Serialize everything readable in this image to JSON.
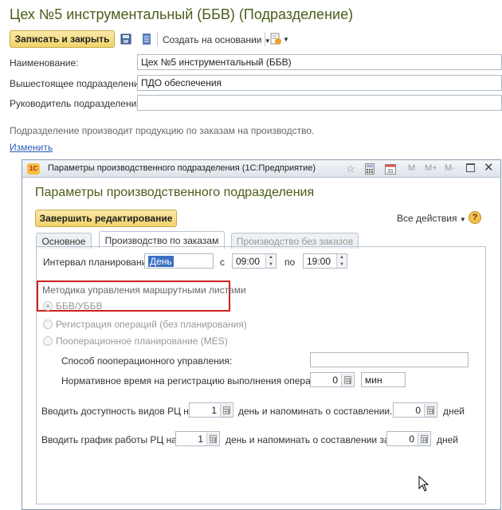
{
  "window": {
    "title": "Цех №5 инструментальный (ББВ) (Подразделение)"
  },
  "toolbar": {
    "save_close_label": "Записать и закрыть",
    "create_based_label": "Создать на основании"
  },
  "form": {
    "name_label": "Наименование:",
    "name_value": "Цех №5 инструментальный (ББВ)",
    "parent_label": "Вышестоящее подразделение:",
    "parent_value": "ПДО обеспечения",
    "head_label": "Руководитель подразделения:",
    "head_value": "",
    "info_text": "Подразделение производит продукцию по заказам на производство.",
    "change_link": "Изменить"
  },
  "dialog": {
    "window_title": "Параметры производственного подразделения  (1С:Предприятие)",
    "header": "Параметры производственного подразделения",
    "finish_button": "Завершить редактирование",
    "all_actions": "Все действия",
    "help": "?",
    "tabs": [
      {
        "label": "Основное"
      },
      {
        "label": "Производство по заказам"
      },
      {
        "label": "Производство без заказов"
      }
    ],
    "interval_label": "Интервал планирования:",
    "interval_value": "День",
    "from_label": "с",
    "from_value": "09:00",
    "to_label": "по",
    "to_value": "19:00",
    "route_method_label": "Методика управления маршрутными листами",
    "radio_options": [
      {
        "label": "ББВ/УББВ",
        "checked": true
      },
      {
        "label": "Регистрация операций (без планирования)",
        "checked": false
      },
      {
        "label": "Пооперационное планирование (MES)",
        "checked": false
      }
    ],
    "op_mgmt_label": "Способ пооперационного управления:",
    "op_mgmt_value": "",
    "norm_time_label": "Нормативное время на регистрацию выполнения операций:",
    "norm_time_value": "0",
    "norm_time_unit": "мин",
    "avail_label": "Вводить доступность видов РЦ на",
    "avail_value": "1",
    "avail_mid": "день и напоминать о составлении...",
    "avail_remind": "0",
    "avail_unit": "дней",
    "schedule_label": "Вводить график работы РЦ на",
    "schedule_value": "1",
    "schedule_mid": "день и напоминать о составлении за",
    "schedule_remind": "0",
    "schedule_unit": "дней",
    "title_buttons": [
      "M",
      "M+",
      "M-"
    ]
  },
  "colors": {
    "title_green": "#4a5e1a",
    "highlight_red": "#d02020",
    "link_blue": "#2b5db8"
  }
}
